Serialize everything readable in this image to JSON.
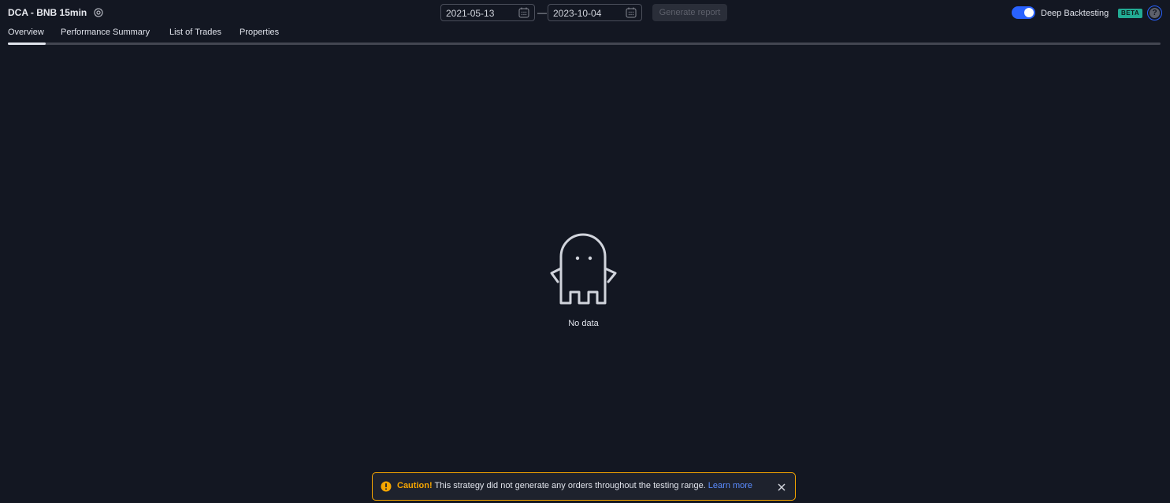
{
  "header": {
    "strategy_title": "DCA - BNB 15min",
    "start_date": "2021-05-13",
    "date_separator": "—",
    "end_date": "2023-10-04",
    "generate_label": "Generate report",
    "deep_backtesting_label": "Deep Backtesting",
    "deep_backtesting_enabled": true,
    "beta_label": "BETA",
    "help_symbol": "?"
  },
  "tabs": [
    {
      "label": "Overview",
      "active": true
    },
    {
      "label": "Performance Summary",
      "active": false
    },
    {
      "label": "List of Trades",
      "active": false
    },
    {
      "label": "Properties",
      "active": false
    }
  ],
  "empty_state": {
    "icon": "ghost-icon",
    "message": "No data"
  },
  "caution": {
    "title": "Caution!",
    "message": " This strategy did not generate any orders throughout the testing range. ",
    "link_label": "Learn more"
  },
  "colors": {
    "background": "#131722",
    "accent": "#2962ff",
    "warning": "#f7a600",
    "beta": "#22ab94",
    "link": "#5b8cff"
  }
}
